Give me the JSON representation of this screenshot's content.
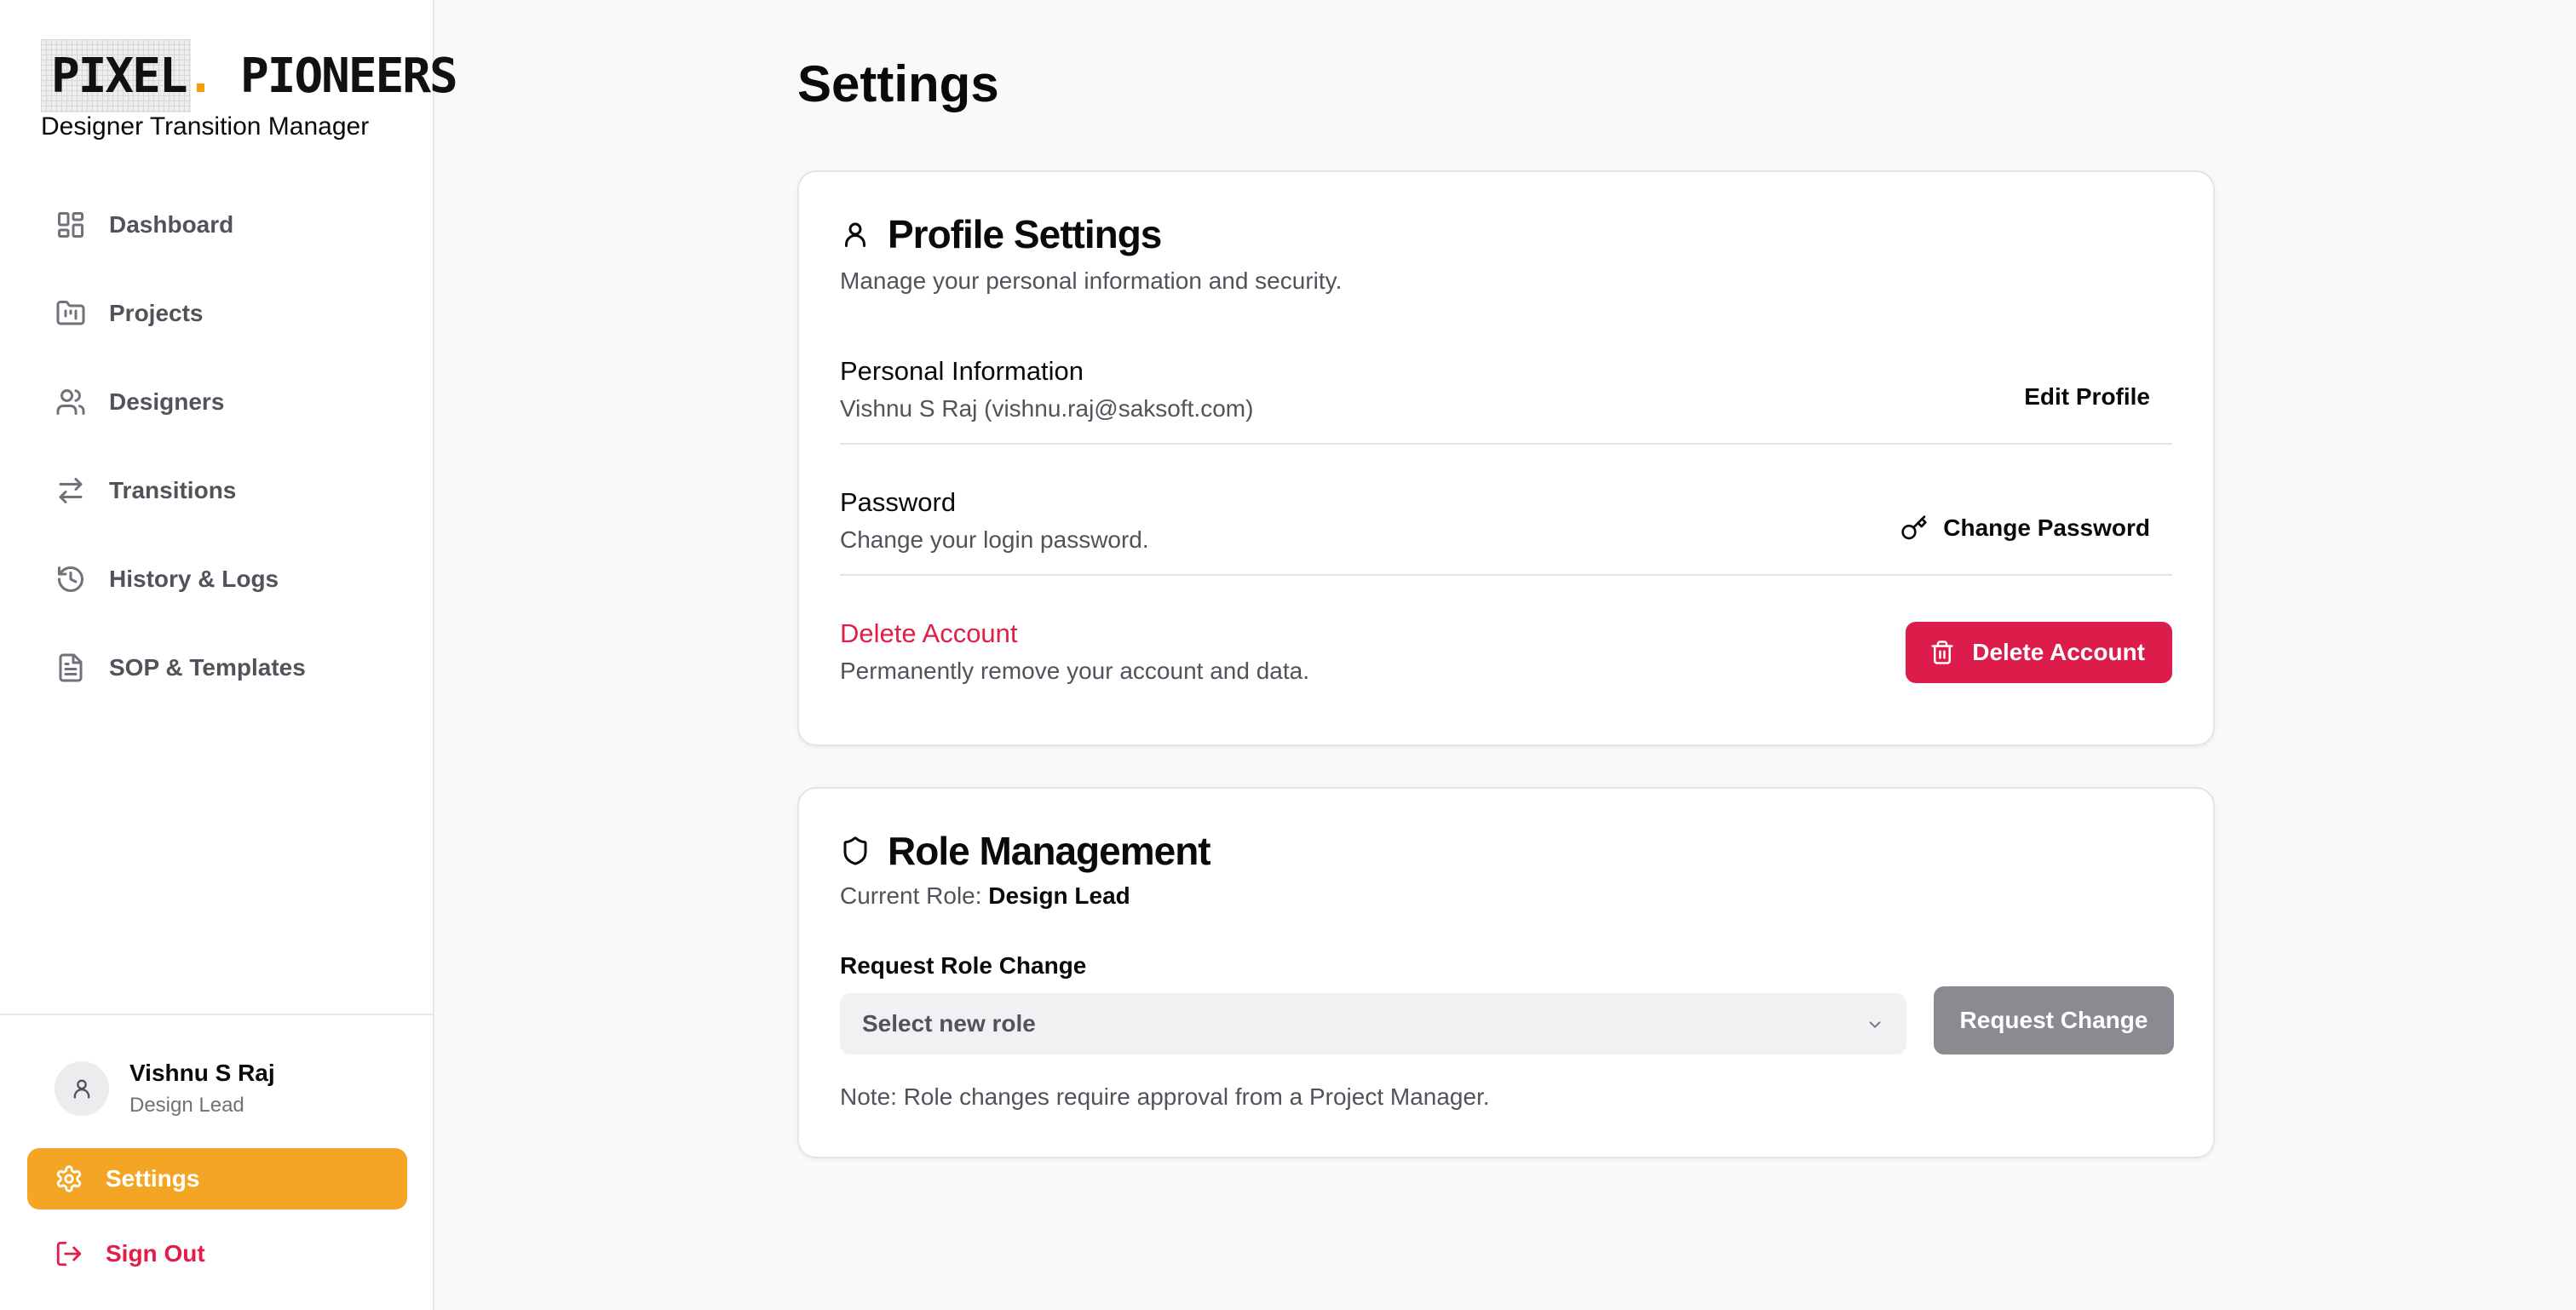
{
  "brand": {
    "logo_part1": "PIXEL",
    "logo_dot": ".",
    "logo_part2": "PIONEERS",
    "subtitle": "Designer Transition Manager"
  },
  "sidebar": {
    "items": [
      {
        "label": "Dashboard",
        "icon": "dashboard-icon"
      },
      {
        "label": "Projects",
        "icon": "folder-kanban-icon"
      },
      {
        "label": "Designers",
        "icon": "users-icon"
      },
      {
        "label": "Transitions",
        "icon": "arrows-left-right-icon"
      },
      {
        "label": "History & Logs",
        "icon": "history-icon"
      },
      {
        "label": "SOP & Templates",
        "icon": "file-text-icon"
      }
    ],
    "user": {
      "name": "Vishnu S Raj",
      "role": "Design Lead"
    },
    "settings_label": "Settings",
    "signout_label": "Sign Out"
  },
  "page": {
    "title": "Settings"
  },
  "profile": {
    "title": "Profile Settings",
    "description": "Manage your personal information and security.",
    "personal": {
      "title": "Personal Information",
      "value": "Vishnu S Raj (vishnu.raj@saksoft.com)",
      "button": "Edit Profile"
    },
    "password": {
      "title": "Password",
      "description": "Change your login password.",
      "button": "Change Password"
    },
    "delete": {
      "title": "Delete Account",
      "description": "Permanently remove your account and data.",
      "button": "Delete Account"
    }
  },
  "role": {
    "title": "Role Management",
    "current_label": "Current Role:",
    "current_value": "Design Lead",
    "request_label": "Request Role Change",
    "select_placeholder": "Select new role",
    "button": "Request Change",
    "note": "Note: Role changes require approval from a Project Manager."
  },
  "colors": {
    "accent": "#f5a524",
    "danger": "#dc1c4a",
    "muted_button": "#8a8a90"
  }
}
